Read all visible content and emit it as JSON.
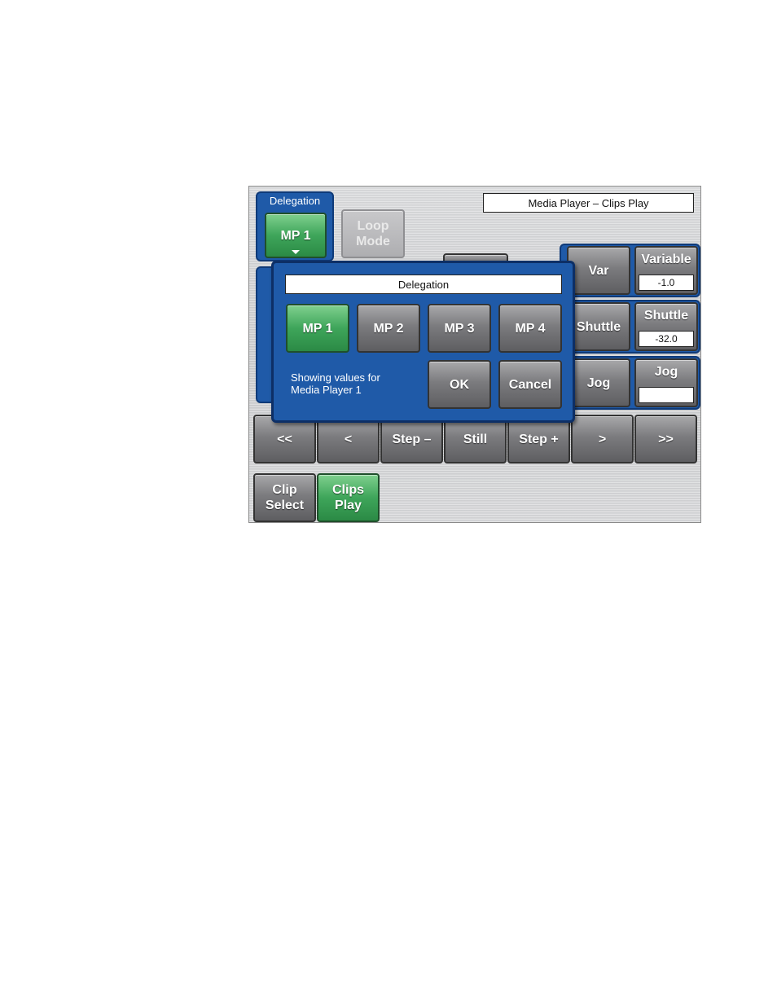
{
  "header": {
    "title": "Media Player – Clips Play"
  },
  "delegation_group": {
    "label": "Delegation",
    "button_label": "MP 1"
  },
  "loop_mode": {
    "line1": "Loop",
    "line2": "Mode"
  },
  "modes": {
    "var": {
      "label": "Var",
      "value_label": "Variable",
      "value": "-1.0"
    },
    "shuttle": {
      "label": "Shuttle",
      "value_label": "Shuttle",
      "value": "-32.0"
    },
    "jog": {
      "label": "Jog",
      "value_label": "Jog",
      "value": ""
    }
  },
  "transport": [
    "<<",
    "<",
    "Step –",
    "Still",
    "Step +",
    ">",
    ">>"
  ],
  "bottom_tabs": {
    "clip_select": {
      "line1": "Clip",
      "line2": "Select"
    },
    "clips_play": {
      "line1": "Clips",
      "line2": "Play"
    }
  },
  "dialog": {
    "title": "Delegation",
    "buttons": [
      "MP 1",
      "MP 2",
      "MP 3",
      "MP 4"
    ],
    "selected": "MP 1",
    "message_line1": "Showing values for",
    "message_line2": "Media Player 1",
    "ok_label": "OK",
    "cancel_label": "Cancel"
  },
  "colors": {
    "panel_blue": "#1f5aa8",
    "selected_green": "#3ea55a"
  }
}
